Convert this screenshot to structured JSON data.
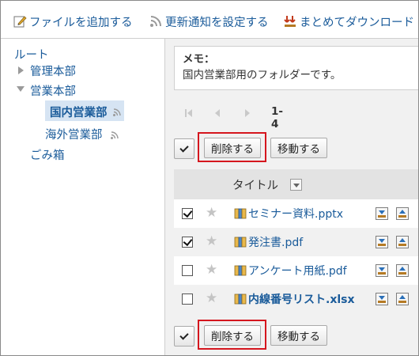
{
  "toolbar": {
    "add_file": "ファイルを追加する",
    "notify": "更新通知を設定する",
    "bulk_download": "まとめてダウンロード"
  },
  "tree": {
    "root": "ルート",
    "items": [
      {
        "label": "管理本部",
        "state": "collapsed"
      },
      {
        "label": "営業本部",
        "state": "expanded"
      },
      {
        "label": "国内営業部",
        "state": "selected"
      },
      {
        "label": "海外営業部",
        "state": "normal"
      },
      {
        "label": "ごみ箱",
        "state": "normal"
      }
    ]
  },
  "memo": {
    "label": "メモ：",
    "text": "国内営業部用のフォルダーです。"
  },
  "pager": {
    "range": "1-4"
  },
  "actions": {
    "delete": "削除する",
    "move": "移動する"
  },
  "table": {
    "header_title": "タイトル",
    "rows": [
      {
        "name": "セミナー資料.pptx",
        "checked": true,
        "unread": false
      },
      {
        "name": "発注書.pdf",
        "checked": true,
        "unread": false
      },
      {
        "name": "アンケート用紙.pdf",
        "checked": false,
        "unread": false
      },
      {
        "name": "内線番号リスト.xlsx",
        "checked": false,
        "unread": true
      }
    ]
  },
  "colors": {
    "link": "#1a5b9a",
    "highlight": "#d5161e",
    "selected_bg": "#d6e4f3"
  }
}
